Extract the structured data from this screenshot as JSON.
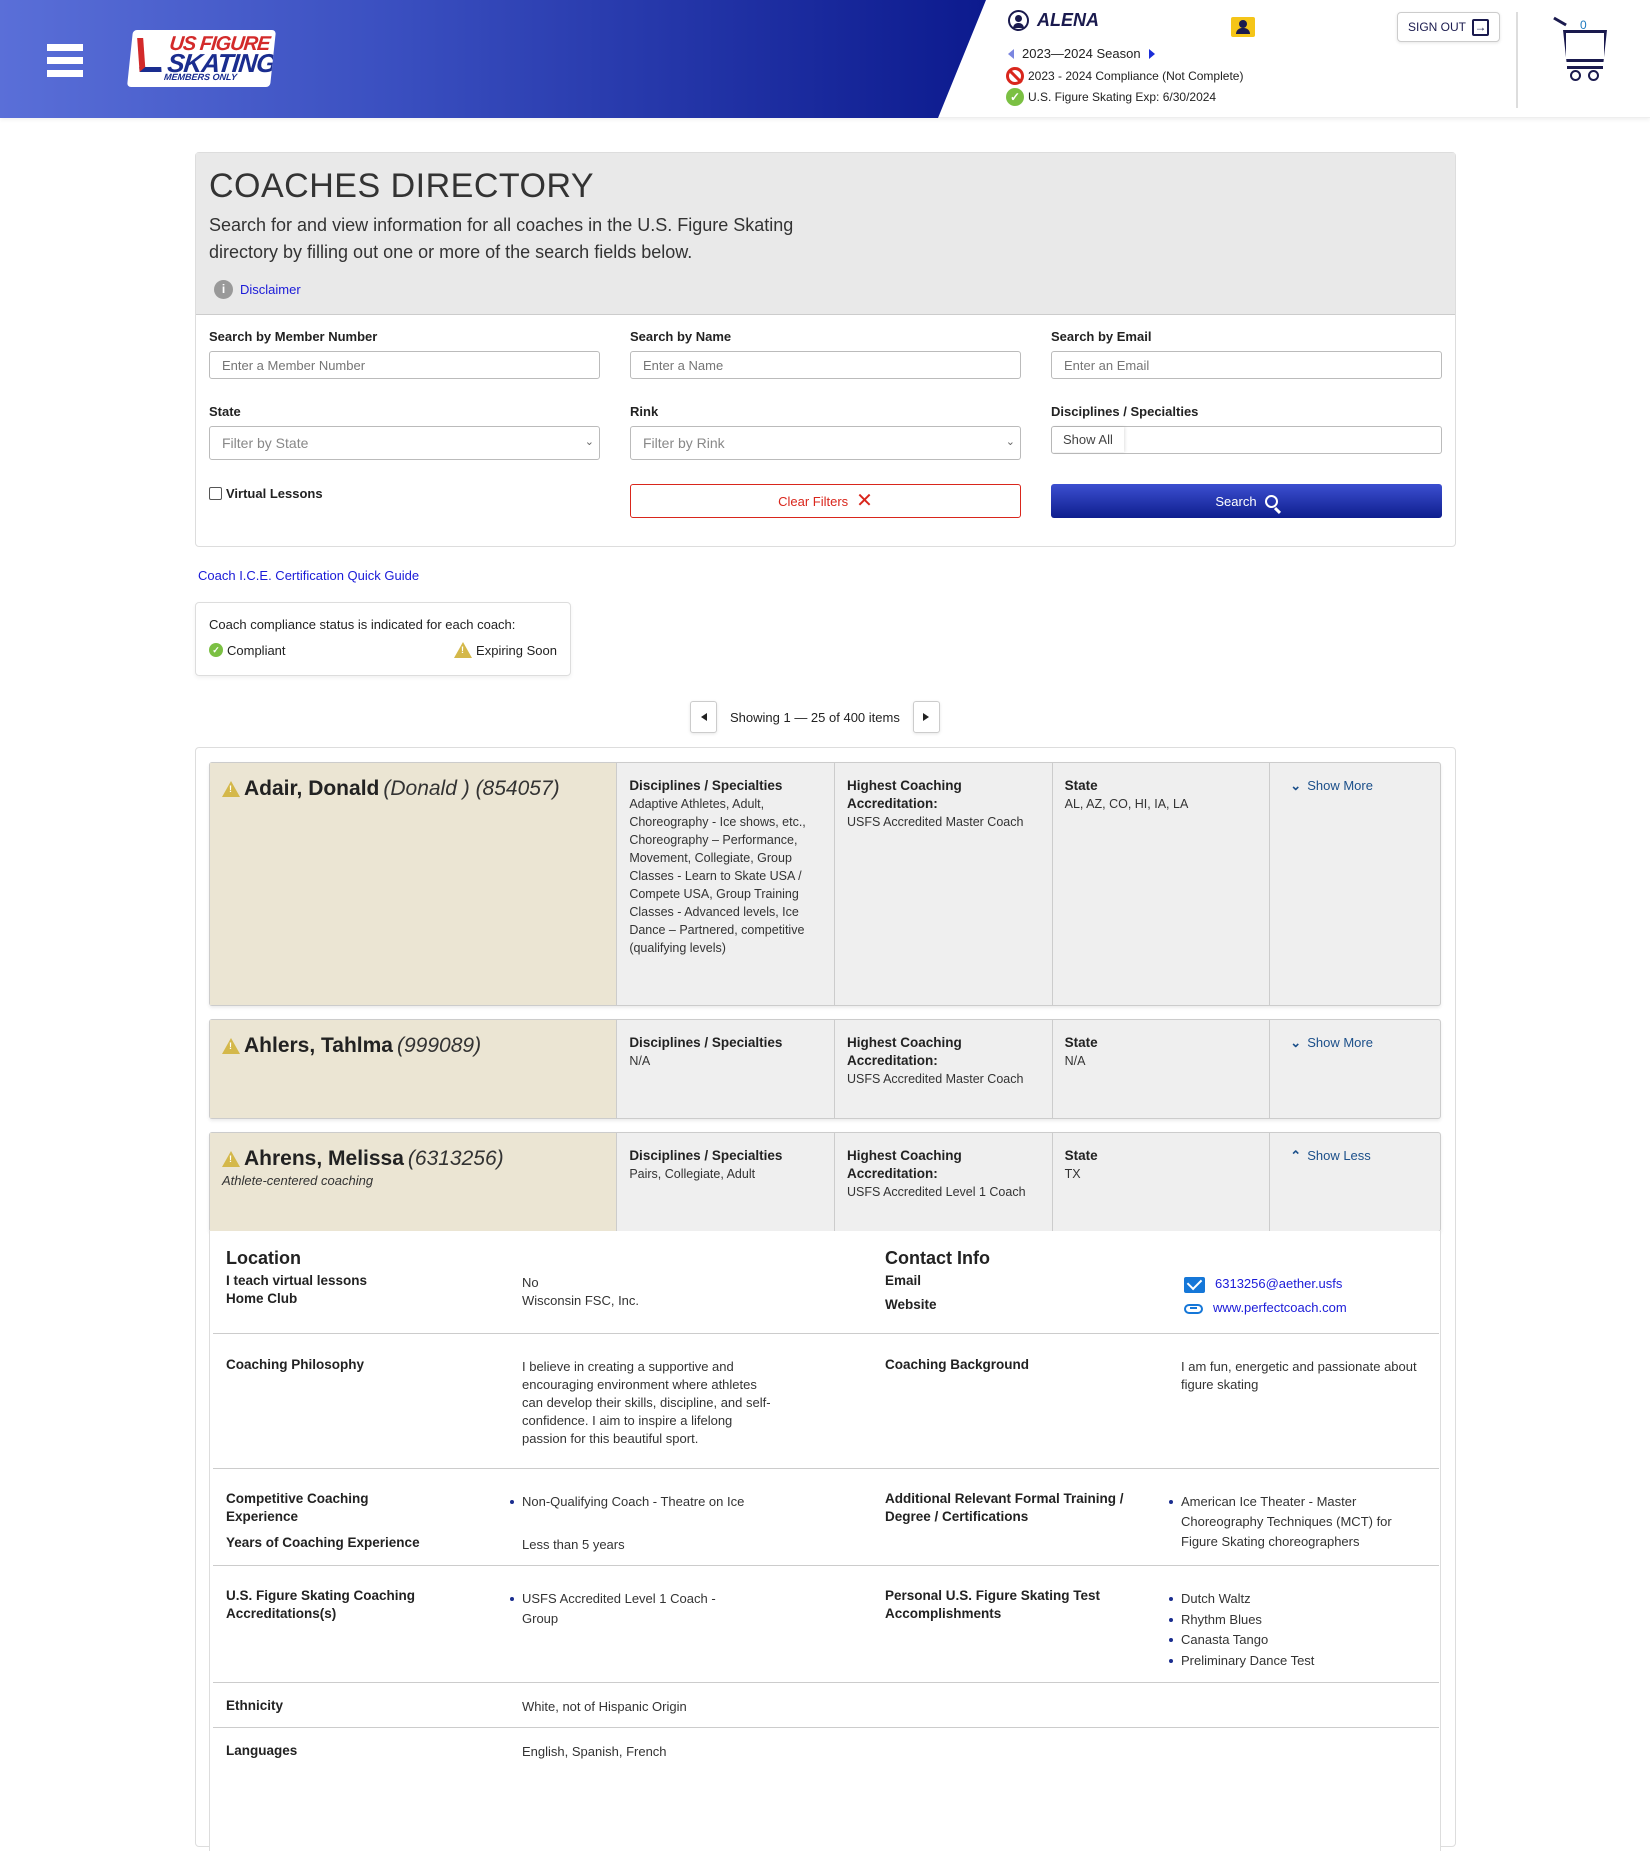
{
  "header": {
    "logo": {
      "line1": "US FIGURE",
      "line2": "SKATING",
      "line3": "MEMBERS ONLY"
    },
    "user_name": "ALENA",
    "season": "2023—2024 Season",
    "compliance": "2023 - 2024 Compliance (Not Complete)",
    "membership_exp": "U.S. Figure Skating Exp: 6/30/2024",
    "sign_out_label": "SIGN OUT",
    "cart_count": "0"
  },
  "intro": {
    "title": "COACHES DIRECTORY",
    "description": "Search for and view information for all coaches in the U.S. Figure Skating directory by filling out one or more of the search fields below.",
    "disclaimer_label": "Disclaimer"
  },
  "search": {
    "member_number": {
      "label": "Search by Member Number",
      "placeholder": "Enter a Member Number",
      "value": ""
    },
    "name": {
      "label": "Search by Name",
      "placeholder": "Enter a Name",
      "value": ""
    },
    "email": {
      "label": "Search by Email",
      "placeholder": "Enter an Email",
      "value": ""
    },
    "state": {
      "label": "State",
      "selected": "Filter by State"
    },
    "rink": {
      "label": "Rink",
      "selected": "Filter by Rink"
    },
    "disciplines": {
      "label": "Disciplines / Specialties",
      "selected": "Show All"
    },
    "virtual_lessons": {
      "label": "Virtual Lessons",
      "checked": false
    },
    "clear_label": "Clear Filters",
    "search_label": "Search"
  },
  "guide_link": "Coach I.C.E. Certification Quick Guide",
  "legend": {
    "text": "Coach compliance status is indicated for each coach:",
    "compliant": "Compliant",
    "expiring": "Expiring Soon"
  },
  "pagination": {
    "text": "Showing 1 — 25 of 400 items"
  },
  "column_labels": {
    "disciplines": "Disciplines / Specialties",
    "accreditation": "Highest Coaching Accreditation:",
    "state": "State"
  },
  "coaches": [
    {
      "name": "Adair, Donald",
      "extra": "(Donald ) (854057)",
      "tagline": "",
      "status": "expiring",
      "disciplines": "Adaptive Athletes, Adult, Choreography - Ice shows, etc., Choreography – Performance, Movement, Collegiate, Group Classes - Learn to Skate USA / Compete USA, Group Training Classes - Advanced levels, Ice Dance – Partnered, competitive (qualifying levels)",
      "accreditation": "USFS Accredited Master Coach",
      "state": "AL, AZ, CO, HI, IA, LA",
      "toggle_label": "Show More"
    },
    {
      "name": "Ahlers, Tahlma",
      "extra": "(999089)",
      "tagline": "",
      "status": "expiring",
      "disciplines": "N/A",
      "accreditation": "USFS Accredited Master Coach",
      "state": "N/A",
      "toggle_label": "Show More"
    },
    {
      "name": "Ahrens, Melissa",
      "extra": "(6313256)",
      "tagline": "Athlete-centered coaching",
      "status": "expiring",
      "disciplines": "Pairs, Collegiate, Adult",
      "accreditation": "USFS Accredited Level 1 Coach",
      "state": "TX",
      "toggle_label": "Show Less"
    }
  ],
  "detail": {
    "location_heading": "Location",
    "virtual_label": "I teach virtual lessons",
    "virtual_value": "No",
    "home_club_label": "Home Club",
    "home_club_value": "Wisconsin FSC, Inc.",
    "contact_heading": "Contact Info",
    "email_label": "Email",
    "email_value": "6313256@aether.usfs",
    "website_label": "Website",
    "website_value": "www.perfectcoach.com",
    "philosophy_label": "Coaching Philosophy",
    "philosophy_value": "I believe in creating a supportive and encouraging environment where athletes can develop their skills, discipline, and self-confidence. I aim to inspire a lifelong passion for this beautiful sport.",
    "background_label": "Coaching Background",
    "background_value": "I am fun, energetic and passionate about figure skating",
    "competitive_label": "Competitive Coaching Experience",
    "competitive_items": [
      "Non-Qualifying Coach - Theatre on Ice"
    ],
    "years_label": "Years of Coaching Experience",
    "years_value": "Less than 5 years",
    "additional_label": "Additional Relevant Formal Training / Degree / Certifications",
    "additional_items": [
      "American Ice Theater - Master Choreography Techniques (MCT) for Figure Skating choreographers"
    ],
    "accreditations_label": "U.S. Figure Skating Coaching Accreditations(s)",
    "accreditations_items": [
      "USFS Accredited Level 1 Coach - Group"
    ],
    "tests_label": "Personal U.S. Figure Skating Test Accomplishments",
    "tests_items": [
      "Dutch Waltz",
      "Rhythm Blues",
      "Canasta Tango",
      "Preliminary Dance Test"
    ],
    "ethnicity_label": "Ethnicity",
    "ethnicity_value": "White, not of Hispanic Origin",
    "languages_label": "Languages",
    "languages_value": "English, Spanish, French"
  }
}
